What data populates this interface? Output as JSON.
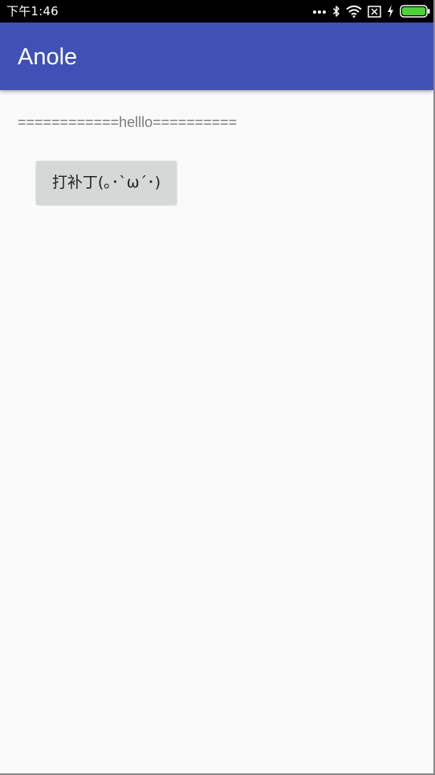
{
  "status_bar": {
    "time": "下午1:46",
    "icons": [
      "more-dots-icon",
      "bluetooth-icon",
      "wifi-icon",
      "no-sim-icon",
      "charging-icon",
      "battery-icon"
    ],
    "battery_color": "#4cd137"
  },
  "app_bar": {
    "title": "Anole",
    "color": "#3f51b5"
  },
  "main": {
    "hello_text": "============helllo==========",
    "patch_button_label": "打补丁(｡･`ω´･)"
  }
}
